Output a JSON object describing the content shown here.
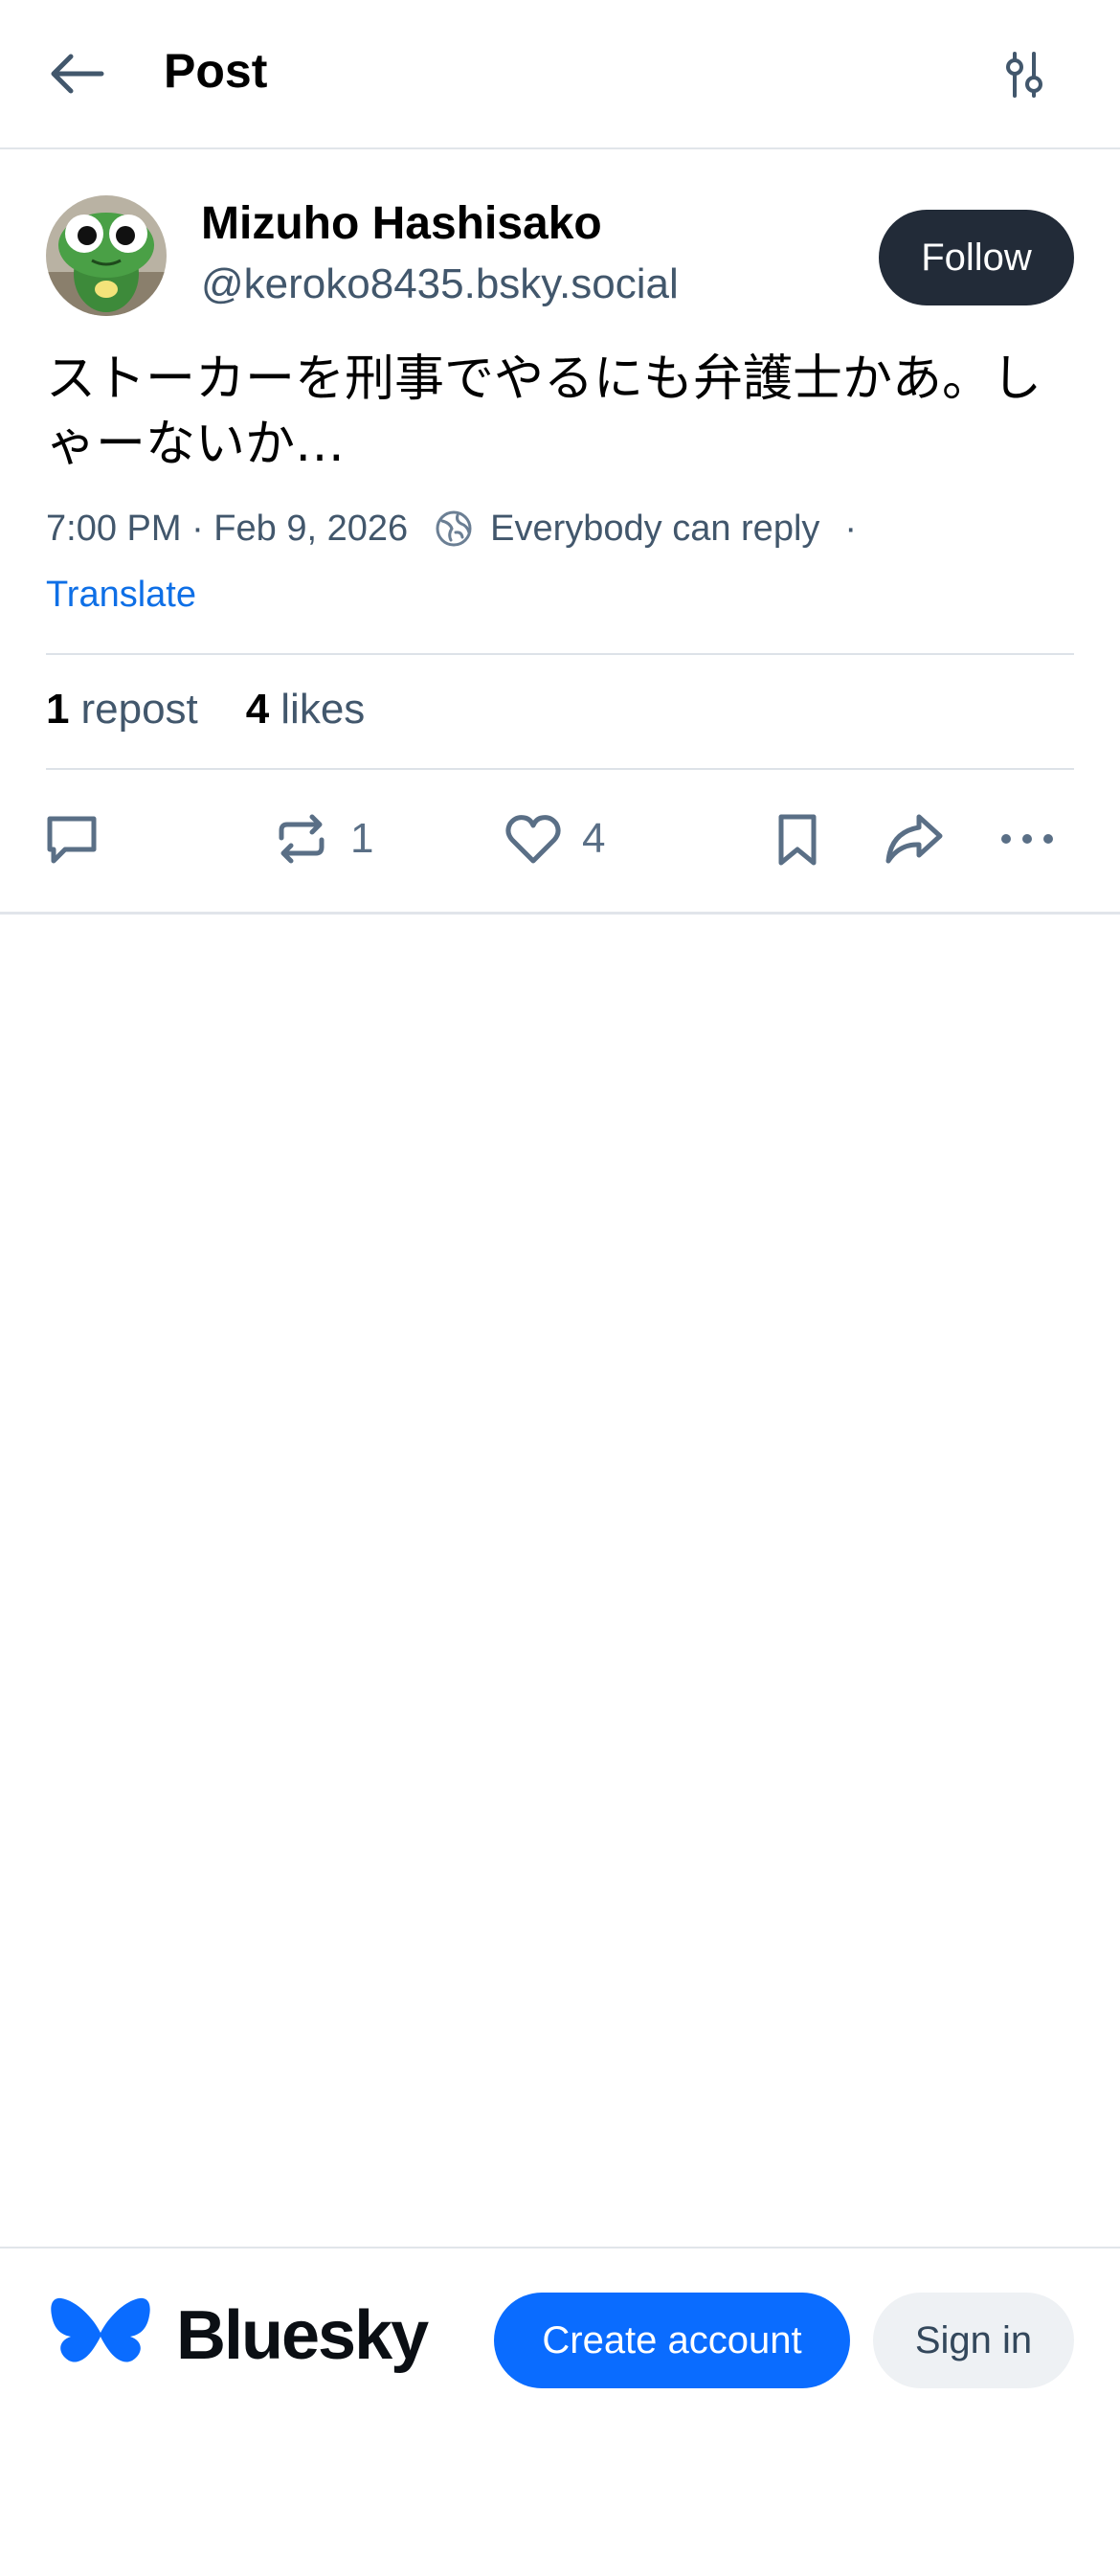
{
  "header": {
    "title": "Post",
    "back_icon": "arrow-left-icon",
    "filter_icon": "sliders-icon"
  },
  "author": {
    "name": "Mizuho Hashisako",
    "handle": "@keroko8435.bsky.social",
    "follow_label": "Follow"
  },
  "post": {
    "text": "ストーカーを刑事でやるにも弁護士かあ。しゃーないか…",
    "timestamp": "7:00 PM · Feb 9, 2026",
    "reply_setting": "Everybody can reply",
    "separator": "·",
    "translate_label": "Translate"
  },
  "stats": {
    "reposts_count": "1",
    "reposts_label": "repost",
    "likes_count": "4",
    "likes_label": "likes"
  },
  "actions": {
    "repost_count": "1",
    "like_count": "4"
  },
  "footer": {
    "brand": "Bluesky",
    "create_account_label": "Create account",
    "sign_in_label": "Sign in"
  },
  "colors": {
    "accent": "#0a6cff",
    "link": "#0e6fe6",
    "muted_text": "#42576c",
    "follow_bg": "#222b38"
  }
}
